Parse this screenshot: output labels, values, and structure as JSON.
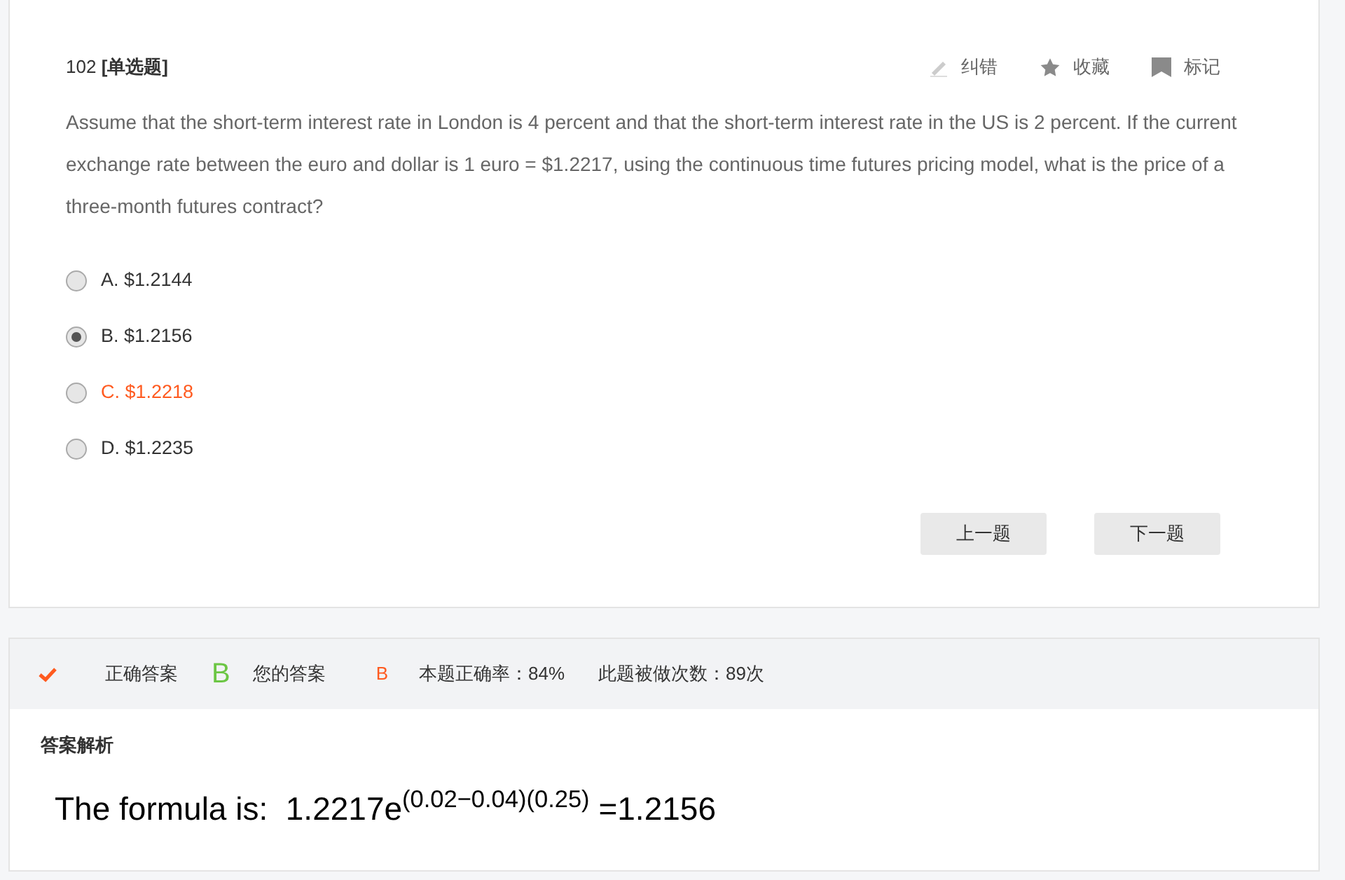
{
  "question": {
    "number": "102",
    "type": "[单选题]",
    "actions": [
      {
        "kind": "pencil",
        "label": "纠错"
      },
      {
        "kind": "star",
        "label": "收藏"
      },
      {
        "kind": "flag",
        "label": "标记"
      }
    ],
    "text": "Assume that the short-term interest rate in London is 4 percent and that the short-term interest rate in the US is 2 percent. If the current exchange rate between the euro and dollar is 1 euro = $1.2217, using the continuous time futures pricing model, what is the price of a three-month futures contract?",
    "options": [
      {
        "label": "A. $1.2144",
        "selected": false,
        "highlighted": false
      },
      {
        "label": "B. $1.2156",
        "selected": true,
        "highlighted": false
      },
      {
        "label": "C. $1.2218",
        "selected": false,
        "highlighted": true
      },
      {
        "label": "D. $1.2235",
        "selected": false,
        "highlighted": false
      }
    ],
    "nav": [
      "上一题",
      "下一题"
    ]
  },
  "result": {
    "correct_label": "正确答案",
    "correct_answer": "B",
    "your_label": "您的答案",
    "your_answer": "B",
    "accuracy": "本题正确率：84%",
    "attempts": "此题被做次数：89次"
  },
  "explanation": {
    "title": "答案解析",
    "formula": "The formula is:  1.2217e$^{(0.02−0.04)(0.25)}$ =1.2156"
  }
}
